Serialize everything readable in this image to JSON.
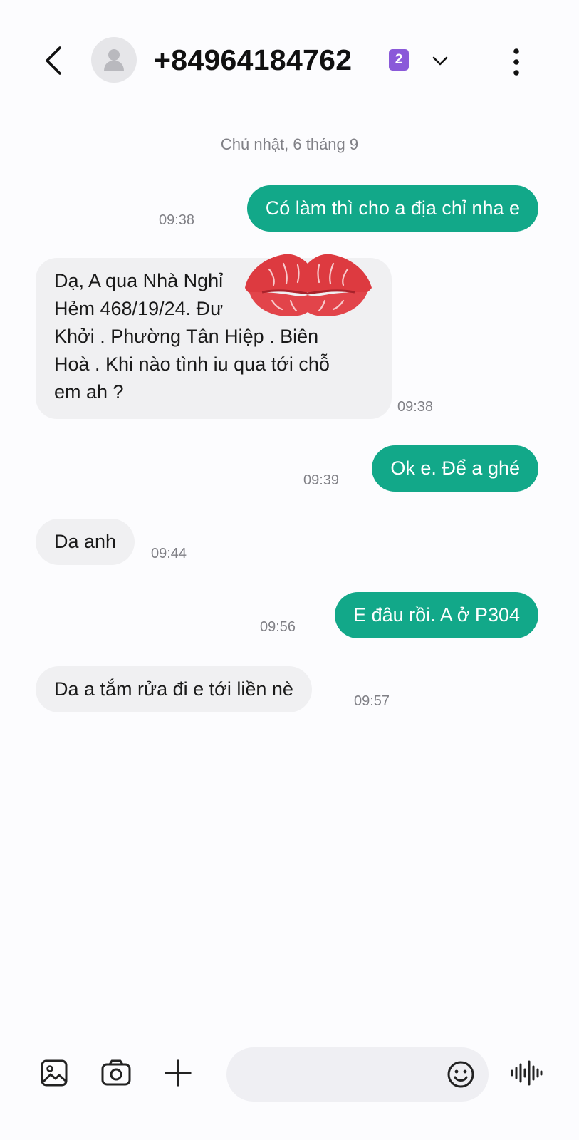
{
  "header": {
    "contact": "+84964184762",
    "sim_badge": "2",
    "icons": {
      "back": "back-arrow-icon",
      "avatar": "person-icon",
      "expand": "chevron-down-icon",
      "more": "more-vertical-icon"
    }
  },
  "conversation": {
    "date_separator": "Chủ nhật, 6 tháng 9",
    "messages": [
      {
        "direction": "sent",
        "text": "Có làm thì cho a địa chỉ nha e",
        "time": "09:38"
      },
      {
        "direction": "received",
        "text": "Dạ, A qua Nhà Nghỉ ...\nHẻm 468/19/24. Đư... ...g\nKhởi . Phường Tân Hiệp . Biên\nHoà . Khi nào tình iu qua tới chỗ\nem ah ?",
        "lines": [
          "Dạ, A qua Nhà Nghỉ",
          "Hẻm 468/19/24. Đư",
          "Khởi . Phường Tân Hiệp . Biên",
          "Hoà . Khi nào tình iu qua tới chỗ",
          "em ah ?"
        ],
        "time": "09:38"
      },
      {
        "direction": "sent",
        "text": "Ok e. Để a ghé",
        "time": "09:39"
      },
      {
        "direction": "received",
        "text": "Da anh",
        "time": "09:44"
      },
      {
        "direction": "sent",
        "text": "E đâu rồi. A ở P304",
        "time": "09:56"
      },
      {
        "direction": "received",
        "text": "Da a tắm rửa đi e tới liền nè",
        "time": "09:57"
      }
    ],
    "overlay": "red-lips-sticker"
  },
  "compose": {
    "placeholder": "",
    "icons": {
      "gallery": "image-icon",
      "camera": "camera-icon",
      "add": "plus-icon",
      "emoji": "emoji-icon",
      "voice": "voice-waveform-icon"
    }
  },
  "colors": {
    "sent_bubble": "#12a889",
    "received_bubble": "#f0f0f2",
    "sim_badge": "#8a59d9",
    "background": "#fcfcfe",
    "timestamp": "#808086"
  }
}
